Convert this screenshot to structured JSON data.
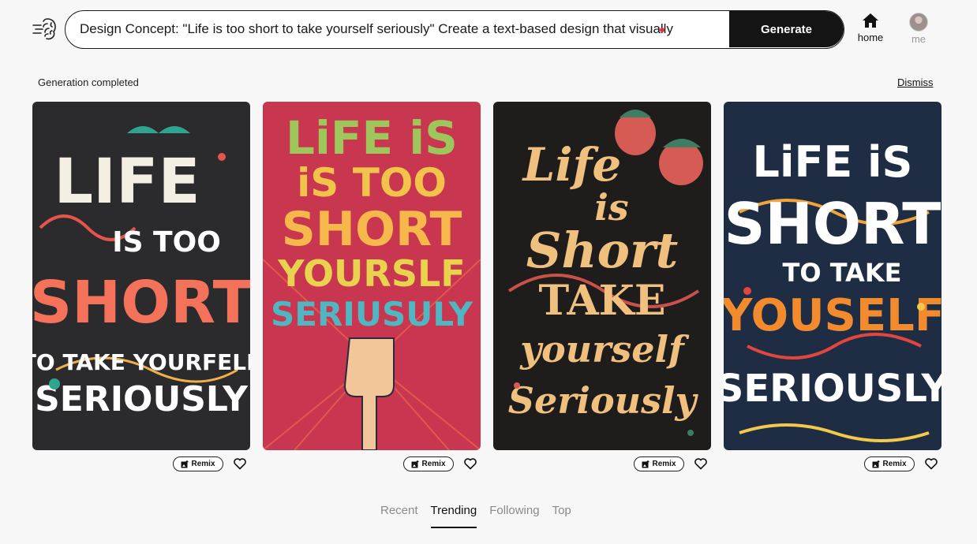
{
  "header": {
    "prompt_value": "Design Concept: \"Life is too short to take yourself seriously\" Create a text-based design that visually",
    "generate_label": "Generate",
    "nav_home_label": "home",
    "nav_me_label": "me"
  },
  "status": {
    "message": "Generation completed",
    "dismiss_label": "Dismiss"
  },
  "cards": [
    {
      "remix_label": "Remix",
      "lines": [
        "LIFE",
        "IS TOO",
        "SHORT",
        "TO TAKE YOURFELF",
        "SERIOUSLY"
      ]
    },
    {
      "remix_label": "Remix",
      "lines": [
        "LiFE iS",
        "iS TOO",
        "SHORT",
        "YOURSLF",
        "SERIUSULY"
      ]
    },
    {
      "remix_label": "Remix",
      "lines": [
        "Life",
        "is",
        "Short",
        "TAKE",
        "yourself",
        "Seriously"
      ]
    },
    {
      "remix_label": "Remix",
      "lines": [
        "LiFE iS",
        "SHORT",
        "TO TAKE",
        "YOUSELF",
        "SERIOUSLY"
      ]
    }
  ],
  "tabs": [
    {
      "label": "Recent",
      "active": false
    },
    {
      "label": "Trending",
      "active": true
    },
    {
      "label": "Following",
      "active": false
    },
    {
      "label": "Top",
      "active": false
    }
  ],
  "icons": {
    "logo": "brain-logo-icon",
    "home": "home-icon",
    "remix": "image-plus-icon",
    "heart": "heart-outline-icon"
  },
  "colors": {
    "accent_button": "#141414",
    "recording_dot": "#e0334a",
    "card1_bg": "#2b2b2e",
    "card2_bg": "#c8364f",
    "card3_bg": "#1f1c1c",
    "card4_bg": "#1f2d44"
  }
}
